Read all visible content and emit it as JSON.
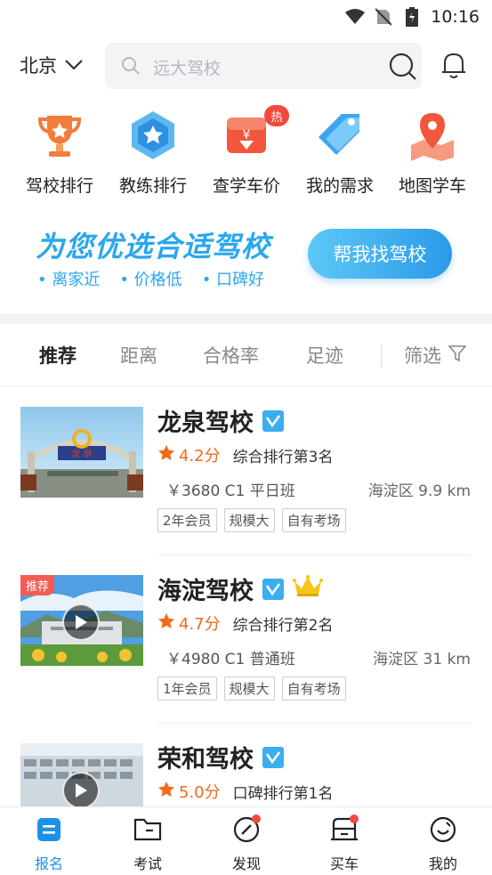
{
  "status_bar": {
    "time": "10:16"
  },
  "header": {
    "city": "北京",
    "search_placeholder": "远大驾校"
  },
  "quick_nav": [
    {
      "label": "驾校排行",
      "icon": "trophy-icon"
    },
    {
      "label": "教练排行",
      "icon": "medal-badge-icon"
    },
    {
      "label": "查学车价",
      "icon": "price-tag-icon",
      "badge": "热"
    },
    {
      "label": "我的需求",
      "icon": "tag-icon"
    },
    {
      "label": "地图学车",
      "icon": "map-pin-icon"
    }
  ],
  "banner": {
    "title": "为您优选合适驾校",
    "tags": [
      "• 离家近",
      "• 价格低",
      "• 口碑好"
    ],
    "button": "帮我找驾校"
  },
  "tabs": {
    "items": [
      "推荐",
      "距离",
      "合格率",
      "足迹"
    ],
    "filter": "筛选"
  },
  "schools": [
    {
      "name": "龙泉驾校",
      "rating": "4.2分",
      "rank": "综合排行第3名",
      "price": "￥3680 C1 平日班",
      "location": "海淀区 9.9 km",
      "tags": [
        "2年会员",
        "规模大",
        "自有考场"
      ],
      "recommended": false,
      "video": false,
      "crown": false
    },
    {
      "name": "海淀驾校",
      "rating": "4.7分",
      "rank": "综合排行第2名",
      "price": "￥4980 C1 普通班",
      "location": "海淀区 31 km",
      "tags": [
        "1年会员",
        "规模大",
        "自有考场"
      ],
      "recommended": true,
      "recommend_label": "推荐",
      "video": true,
      "crown": true
    },
    {
      "name": "荣和驾校",
      "rating": "5.0分",
      "rank": "口碑排行第1名",
      "price": "",
      "location": "",
      "tags": [],
      "recommended": false,
      "video": true,
      "crown": false
    }
  ],
  "bottom_nav": [
    {
      "label": "报名",
      "active": true,
      "dot": false
    },
    {
      "label": "考试",
      "active": false,
      "dot": false
    },
    {
      "label": "发现",
      "active": false,
      "dot": true
    },
    {
      "label": "买车",
      "active": false,
      "dot": true
    },
    {
      "label": "我的",
      "active": false,
      "dot": false
    }
  ],
  "colors": {
    "accent": "#2aa7ee",
    "rating": "#f26a1a",
    "badge": "#f04a3e"
  }
}
